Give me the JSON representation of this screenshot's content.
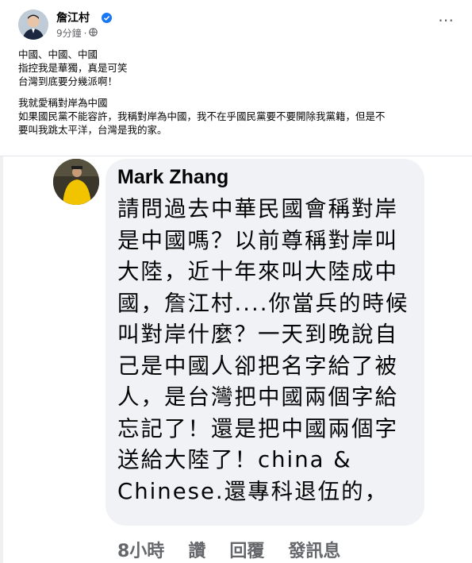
{
  "post": {
    "author": "詹江村",
    "time": "9分鐘",
    "more_icon": "⋯",
    "lines_group1": [
      "中國、中國、中國",
      "指控我是華獨，真是可笑",
      "台灣到底要分幾派啊！"
    ],
    "lines_group2": [
      "我就愛稱對岸為中國",
      "如果國民黨不能容許，我稱對岸為中國，我不在乎國民黨要不要開除我黨籍，但是不",
      "要叫我跳太平洋，台灣是我的家。"
    ]
  },
  "comment": {
    "author": "Mark Zhang",
    "lines": [
      "請問過去中華民國會稱對岸",
      "是中國嗎？以前尊稱對岸叫",
      "大陸，近十年來叫大陸成中",
      "國，詹江村....你當兵的時候",
      "叫對岸什麼？一天到晚說自",
      "己是中國人卻把名字給了被",
      "人，是台灣把中國兩個字給",
      "忘記了！還是把中國兩個字",
      "送給大陸了！china &",
      "Chinese.還專科退伍的，"
    ],
    "time": "8小時",
    "actions": [
      "讚",
      "回覆",
      "發訊息"
    ]
  },
  "colors": {
    "verified": "#1877f2",
    "meta": "#65676b",
    "bubble": "#f0f2f5"
  },
  "icons": {
    "verified": "verified-badge-icon",
    "privacy": "globe-icon",
    "more": "more-options-icon"
  }
}
